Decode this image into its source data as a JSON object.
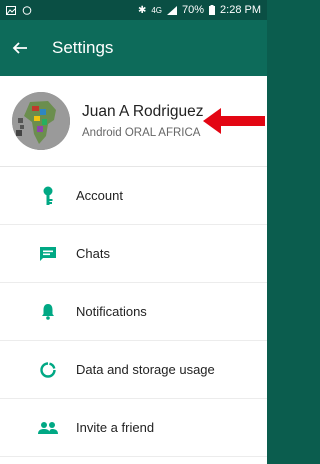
{
  "status_bar": {
    "battery_percent": "70%",
    "time": "2:28 PM",
    "network": "4G"
  },
  "app_bar": {
    "title": "Settings"
  },
  "profile": {
    "name": "Juan A Rodriguez",
    "status": "Android ORAL AFRICA"
  },
  "menu": {
    "items": [
      {
        "label": "Account",
        "icon": "key-icon"
      },
      {
        "label": "Chats",
        "icon": "chat-icon"
      },
      {
        "label": "Notifications",
        "icon": "bell-icon"
      },
      {
        "label": "Data and storage usage",
        "icon": "data-usage-icon"
      },
      {
        "label": "Invite a friend",
        "icon": "people-icon"
      }
    ]
  },
  "colors": {
    "primary": "#0d6b5a",
    "primary_dark": "#0a4f44",
    "accent_icon": "#00a884",
    "annotation_arrow": "#e30613"
  }
}
